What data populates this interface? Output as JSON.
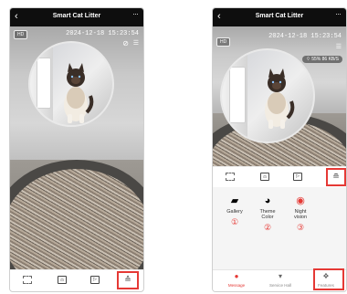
{
  "app": {
    "title": "Smart Cat Litter",
    "back_icon": "chevron-left-icon",
    "more_icon": "more-dots-icon"
  },
  "video": {
    "quality_badge": "HD",
    "timestamp": "2024-12-18 15:23:54",
    "wifi_signal": "55%",
    "bitrate": "86 KB/S",
    "mute_icon": "mic-off-icon",
    "list_icon": "list-icon"
  },
  "controls": {
    "fullscreen_icon": "fullscreen-icon",
    "screenshot_icon": "screenshot-icon",
    "record_icon": "record-icon",
    "features_toggle_icon": "expand-up-icon"
  },
  "features": [
    {
      "label": "Gallery",
      "number": "①",
      "icon": "gallery-icon"
    },
    {
      "label": "Theme\nColor",
      "number": "②",
      "icon": "palette-icon"
    },
    {
      "label": "Night\nvision",
      "number": "③",
      "icon": "night-vision-icon"
    }
  ],
  "tabs": [
    {
      "label": "Message",
      "icon": "bell-icon",
      "active": true
    },
    {
      "label": "Service Hall",
      "icon": "cart-icon",
      "active": false
    },
    {
      "label": "Features",
      "icon": "features-icon",
      "active": false
    }
  ],
  "colors": {
    "accent": "#e53935",
    "header_bg": "#0e0e0e"
  }
}
